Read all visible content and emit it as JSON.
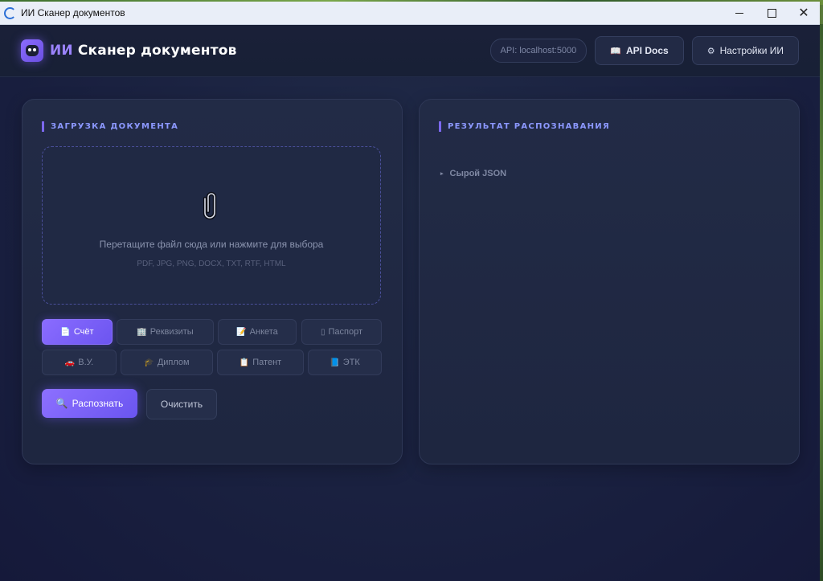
{
  "window": {
    "title": "ИИ Сканер документов",
    "controls": {
      "minimize": "minimize",
      "maximize": "maximize",
      "close": "✕"
    }
  },
  "header": {
    "brand_accent": "ИИ",
    "brand_text": "Сканер документов",
    "api_status": "API: localhost:5000",
    "api_docs_icon": "📖",
    "api_docs_label": "API Docs",
    "settings_icon": "⚙",
    "settings_label": "Настройки ИИ"
  },
  "upload_panel": {
    "title": "ЗАГРУЗКА ДОКУМЕНТА",
    "dropzone_text": "Перетащите файл сюда или нажмите для выбора",
    "dropzone_formats": "PDF, JPG, PNG, DOCX, TXT, RTF, HTML",
    "doc_types": [
      {
        "icon": "📄",
        "label": "Счёт",
        "active": true
      },
      {
        "icon": "🏢",
        "label": "Реквизиты",
        "active": false
      },
      {
        "icon": "📝",
        "label": "Анкета",
        "active": false
      },
      {
        "icon": "▯",
        "label": "Паспорт",
        "active": false
      },
      {
        "icon": "🚗",
        "label": "В.У.",
        "active": false
      },
      {
        "icon": "🎓",
        "label": "Диплом",
        "active": false
      },
      {
        "icon": "📋",
        "label": "Патент",
        "active": false
      },
      {
        "icon": "📘",
        "label": "ЭТК",
        "active": false
      }
    ],
    "recognize_icon": "🔍",
    "recognize_label": "Распознать",
    "clear_label": "Очистить"
  },
  "result_panel": {
    "title": "РЕЗУЛЬТАТ РАСПОЗНАВАНИЯ",
    "raw_json_arrow": "▸",
    "raw_json_label": "Сырой JSON"
  },
  "colors": {
    "accent": "#7b68ee",
    "accent_text": "#8c98ff",
    "background": "#1a2140",
    "panel": "#222b46"
  }
}
